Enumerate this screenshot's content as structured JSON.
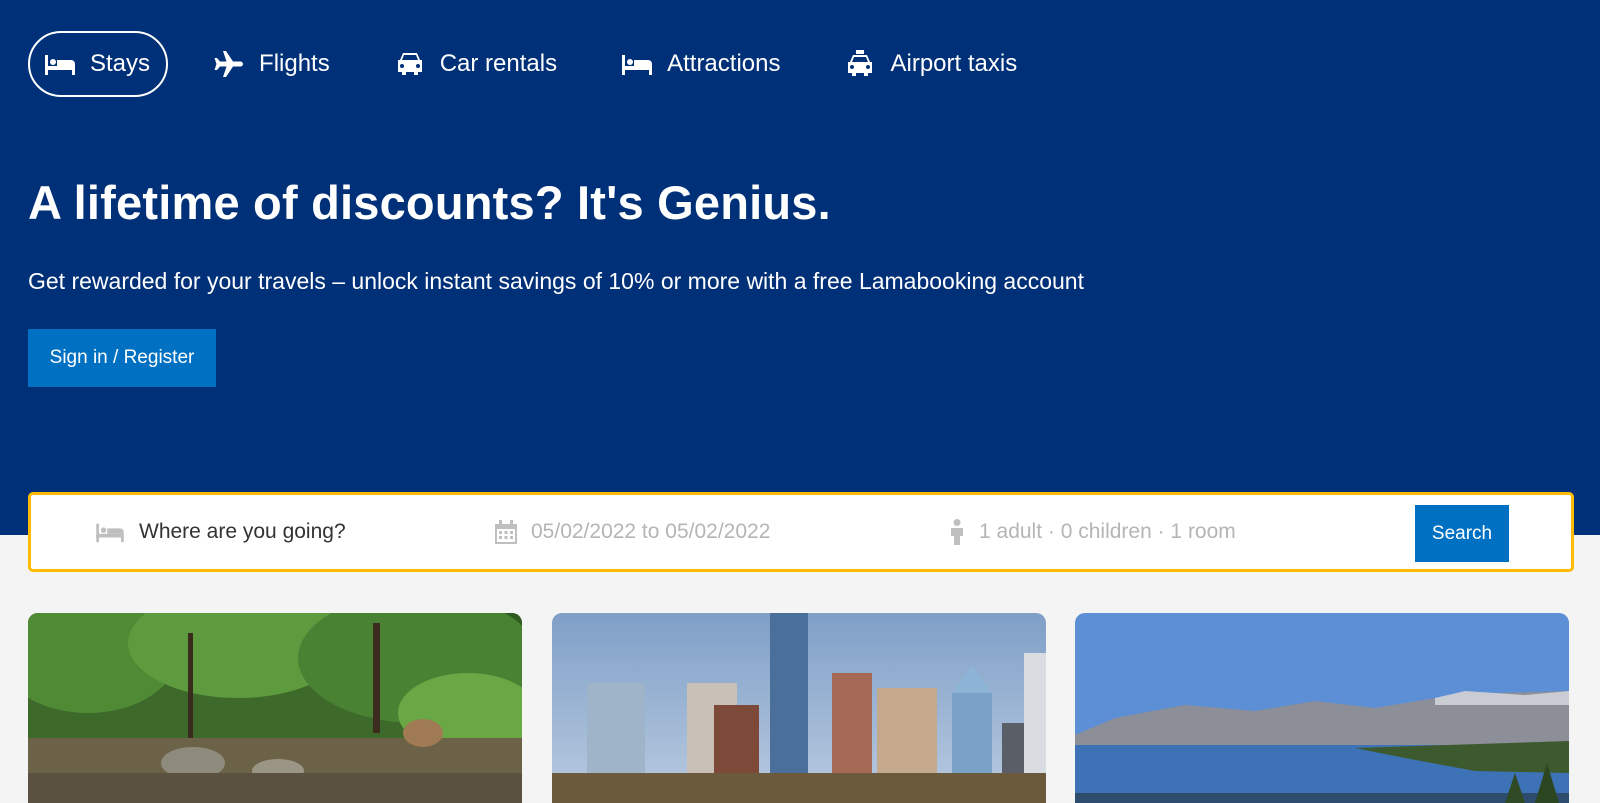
{
  "nav": {
    "items": [
      {
        "label": "Stays",
        "icon": "bed-icon",
        "active": true
      },
      {
        "label": "Flights",
        "icon": "plane-icon",
        "active": false
      },
      {
        "label": "Car rentals",
        "icon": "car-icon",
        "active": false
      },
      {
        "label": "Attractions",
        "icon": "bed-icon",
        "active": false
      },
      {
        "label": "Airport taxis",
        "icon": "taxi-icon",
        "active": false
      }
    ]
  },
  "hero": {
    "title": "A lifetime of discounts? It's Genius.",
    "subtitle": "Get rewarded for your travels – unlock instant savings of 10% or more with a free Lamabooking account",
    "signin_label": "Sign in / Register"
  },
  "search": {
    "destination_placeholder": "Where are you going?",
    "dates": "05/02/2022 to 05/02/2022",
    "guests": "1 adult · 0 children · 1 room",
    "button_label": "Search"
  },
  "colors": {
    "hero_bg": "#003077",
    "button_blue": "#0071c2",
    "search_border": "#febb02"
  },
  "featured": [
    {
      "image": "forest-stream"
    },
    {
      "image": "city-skyline"
    },
    {
      "image": "mountain-lake"
    }
  ]
}
